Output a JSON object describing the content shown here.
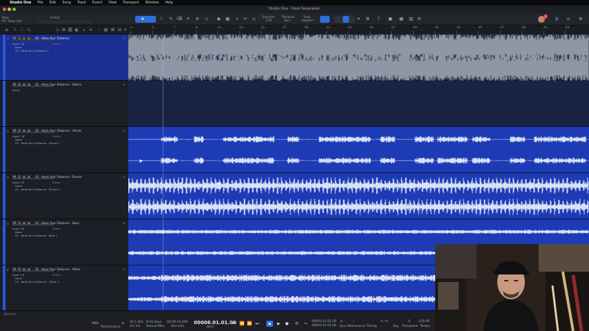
{
  "menubar": {
    "app": "Studio One",
    "items": [
      "File",
      "Edit",
      "Song",
      "Track",
      "Event",
      "View",
      "Transport",
      "Window",
      "Help"
    ]
  },
  "window": {
    "title": "Studio One - Stem Separation"
  },
  "toolbar": {
    "song_label": "Mute",
    "song_sub": "00 - Keep.com",
    "control_label": "Control",
    "quantize_label": "Quantize",
    "quantize_value": "1/16",
    "timebase_label": "Timebase",
    "timebase_value": "Bars",
    "snap_label": "Snap",
    "snap_value": "Adaptive",
    "iq_label": "IQ",
    "notification_count": "1"
  },
  "ruler": {
    "marks": [
      "3",
      "5",
      "7",
      "9",
      "11",
      "13",
      "15",
      "17",
      "19",
      "21",
      "23",
      "25",
      "27",
      "29",
      "31",
      "33",
      "35",
      "37",
      "39",
      "41",
      "43"
    ]
  },
  "tracks": [
    {
      "num": "1",
      "name": "02 - Keep Your Distance",
      "input": "Input 7-8",
      "in2": "None",
      "out": "02 - Keep Your Distance 1",
      "mode": "Stereo",
      "selected": true
    },
    {
      "num": "",
      "name": "02 - Keep Your Distance - Stems",
      "input": "None",
      "in2": "",
      "out": "",
      "mode": "",
      "selected": false
    },
    {
      "num": "1",
      "name": "02 - Keep Your Distance - Vocals",
      "input": "Input 7-8",
      "in2": "None",
      "out": "02 - Keep Your Distance - Vocals 1",
      "mode": "Stereo",
      "selected": false
    },
    {
      "num": "2",
      "name": "02 - Keep Your Distance - Drums",
      "input": "Input 7-8",
      "in2": "None",
      "out": "02 - Keep Your Distance - Drums 1",
      "mode": "Stereo",
      "selected": false
    },
    {
      "num": "3",
      "name": "02 - Keep Your Distance - Bass",
      "input": "Input 7-8",
      "in2": "None",
      "out": "02 - Keep Your Distance - Bass 1",
      "mode": "Stereo",
      "selected": false
    },
    {
      "num": "4",
      "name": "02 - Keep Your Distance - Other",
      "input": "Input 7-8",
      "in2": "None",
      "out": "02 - Keep Your Distance - Other 1",
      "mode": "Stereo",
      "selected": false
    }
  ],
  "tracklist_footer": {
    "mode": "Normal"
  },
  "transport": {
    "midi_label": "MIDI",
    "performance_label": "Performance",
    "sample_rate": "44.1 kHz",
    "rate_sub": "0.0 ms",
    "record_days": "9:10 days",
    "record_label": "Record Max",
    "seconds_value": "00:00:10.000",
    "seconds_label": "Seconds",
    "position": "00006.01.01.00",
    "position_label": "Bars",
    "loop_start": "00001.01.01.00",
    "loop_end": "00001.01.01.00",
    "sync_label": "Sync",
    "metronome_label": "Metronome",
    "timing_label": "Timing",
    "time_sig": "4 / 4",
    "key_label": "Key",
    "transpose_value": "0",
    "transpose_label": "Transpose",
    "tempo": "120.00",
    "tempo_label": "Tempo"
  },
  "colors": {
    "accent": "#2c6fd8",
    "track_blue": "#1c3bb5",
    "selected_header": "#1a2f8f",
    "waveform": "#d9e1f5"
  },
  "icons": [
    "arrow-tool-icon",
    "range-tool-icon",
    "split-tool-icon",
    "eraser-tool-icon",
    "paint-tool-icon",
    "mute-tool-icon",
    "bend-tool-icon",
    "listen-tool-icon",
    "play-icon",
    "stop-icon",
    "record-icon",
    "loop-icon"
  ]
}
